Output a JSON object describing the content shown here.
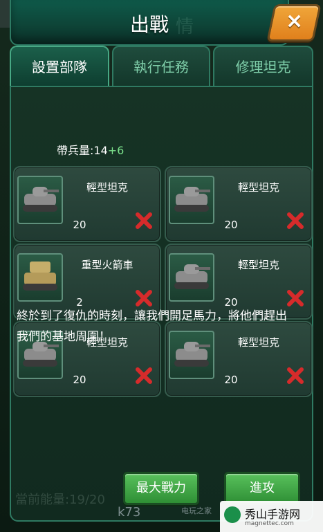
{
  "dialog": {
    "title": "出戰",
    "title_ghost": "主情",
    "close_label": "×"
  },
  "tabs": [
    {
      "label": "設置部隊",
      "active": true
    },
    {
      "label": "執行任務",
      "active": false
    },
    {
      "label": "修理坦克",
      "active": false
    }
  ],
  "troops": {
    "label": "帶兵量:",
    "base": "14",
    "bonus": "+6"
  },
  "units": [
    {
      "name": "輕型坦克",
      "count": "20",
      "icon": "light-tank-icon"
    },
    {
      "name": "輕型坦克",
      "count": "20",
      "icon": "light-tank-icon"
    },
    {
      "name": "重型火箭車",
      "count": "2",
      "icon": "rocket-truck-icon"
    },
    {
      "name": "輕型坦克",
      "count": "20",
      "icon": "light-tank-icon"
    },
    {
      "name": "輕型坦克",
      "count": "20",
      "icon": "light-tank-icon"
    },
    {
      "name": "輕型坦克",
      "count": "20",
      "icon": "light-tank-icon"
    }
  ],
  "message": "終於到了復仇的時刻，讓我們開足馬力，將他們趕出我們的基地周圍！",
  "buttons": {
    "max_power": "最大戰力",
    "attack": "進攻"
  },
  "energy_label": "當前能量:19/20",
  "watermarks": {
    "k73": "k73",
    "k73_sub": "电玩之家",
    "brand_title": "秀山手游网",
    "brand_url": "magnettec.com"
  },
  "colors": {
    "accent_green": "#59c15c",
    "bonus_green": "#7be08b",
    "remove_red": "#d62b2b",
    "close_orange": "#e0801c"
  }
}
